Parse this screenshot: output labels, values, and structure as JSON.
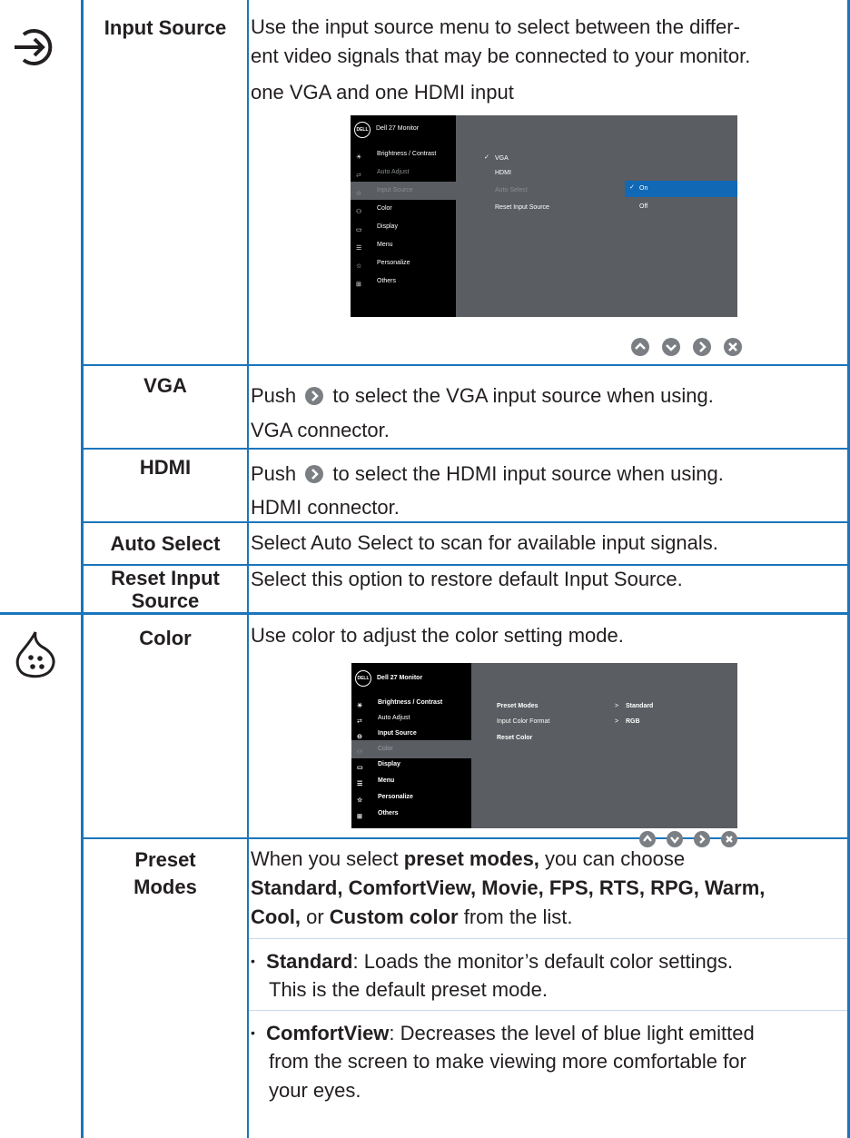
{
  "input_source": {
    "label": "Input Source",
    "desc_line1": "Use the input source menu to select between the differ-",
    "desc_line2": "ent video signals that may be connected to your monitor.",
    "desc_line3": "one VGA and one HDMI input",
    "icon": "input-source-icon"
  },
  "osd1": {
    "header": "Dell 27 Monitor",
    "brand": "DELL",
    "menu": [
      "Brightness / Contrast",
      "Auto Adjust",
      "Input Source",
      "Color",
      "Display",
      "Menu",
      "Personalize",
      "Others"
    ],
    "options": [
      "VGA",
      "HDMI",
      "Auto Select",
      "Reset Input Source"
    ],
    "suboptions": [
      "On",
      "Off"
    ],
    "check": "✓"
  },
  "vga": {
    "label": "VGA",
    "desc_a": "Push",
    "desc_b": "to select the VGA input source when using.",
    "desc_line2": "VGA connector."
  },
  "hdmi": {
    "label": "HDMI",
    "desc_a": "Push",
    "desc_b": "to select the HDMI input source when using.",
    "desc_line2": "HDMI connector."
  },
  "auto_select": {
    "label": "Auto Select",
    "desc": "Select Auto Select to scan for available input signals."
  },
  "reset_input": {
    "label_line1": "Reset Input",
    "label_line2": "Source",
    "desc": "Select this option to restore default Input Source."
  },
  "color": {
    "label": "Color",
    "desc": "Use color to adjust the color setting mode.",
    "icon": "color-palette-icon"
  },
  "osd2": {
    "header": "Dell 27 Monitor",
    "brand": "DELL",
    "menu": [
      "Brightness / Contrast",
      "Auto Adjust",
      "Input Source",
      "Color",
      "Display",
      "Menu",
      "Personalize",
      "Others"
    ],
    "settings": [
      "Preset Modes",
      "Input Color Format",
      "Reset Color"
    ],
    "values": [
      "Standard",
      "RGB"
    ],
    "arrow": ">"
  },
  "preset": {
    "label_line1": "Preset",
    "label_line2": "Modes",
    "l1_a": "When you select ",
    "l1_b": "preset modes,",
    "l1_c": " you can choose",
    "l2": "Standard, ComfortView, Movie, FPS, RTS, RPG, Warm,",
    "l3_a": "Cool,",
    "l3_b": " or ",
    "l3_c": "Custom color",
    "l3_d": " from the list.",
    "b1_a": "Standard",
    "b1_b": ": Loads the monitor’s default color settings.",
    "b1_l2": "This is the default preset mode.",
    "b2_a": "ComfortView",
    "b2_b": ": Decreases the level of blue light emitted",
    "b2_l2": "from the screen to make viewing more comfortable for",
    "b2_l3": "your eyes.",
    "bullet": "•"
  },
  "colors": {
    "table_line": "#1b75bb",
    "osd_highlight": "#1168b5",
    "osd_panel": "#5a5d62"
  }
}
